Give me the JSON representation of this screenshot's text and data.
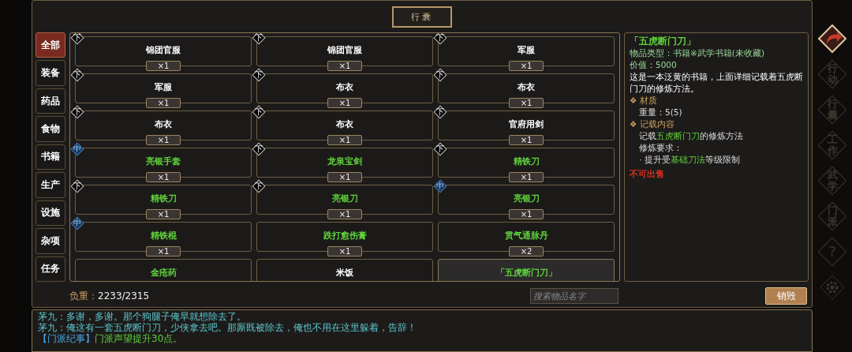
{
  "title": "行囊",
  "categories": [
    {
      "label": "全部",
      "selected": true
    },
    {
      "label": "装备",
      "selected": false
    },
    {
      "label": "药品",
      "selected": false
    },
    {
      "label": "食物",
      "selected": false
    },
    {
      "label": "书籍",
      "selected": false
    },
    {
      "label": "生产",
      "selected": false
    },
    {
      "label": "设施",
      "selected": false
    },
    {
      "label": "杂项",
      "selected": false
    },
    {
      "label": "任务",
      "selected": false
    }
  ],
  "items": [
    {
      "name": "锦团官服",
      "count": "×1",
      "grade": "下",
      "kind": "low",
      "color": "#ffffff",
      "selected": false
    },
    {
      "name": "锦团官服",
      "count": "×1",
      "grade": "下",
      "kind": "low",
      "color": "#ffffff",
      "selected": false
    },
    {
      "name": "军服",
      "count": "×1",
      "grade": "下",
      "kind": "low",
      "color": "#ffffff",
      "selected": false
    },
    {
      "name": "军服",
      "count": "×1",
      "grade": "下",
      "kind": "low",
      "color": "#ffffff",
      "selected": false
    },
    {
      "name": "布衣",
      "count": "×1",
      "grade": "下",
      "kind": "low",
      "color": "#ffffff",
      "selected": false
    },
    {
      "name": "布衣",
      "count": "×1",
      "grade": "下",
      "kind": "low",
      "color": "#ffffff",
      "selected": false
    },
    {
      "name": "布衣",
      "count": "×1",
      "grade": "下",
      "kind": "low",
      "color": "#ffffff",
      "selected": false
    },
    {
      "name": "布衣",
      "count": "×1",
      "grade": "下",
      "kind": "low",
      "color": "#ffffff",
      "selected": false
    },
    {
      "name": "官府用剑",
      "count": "×1",
      "grade": "下",
      "kind": "low",
      "color": "#ffffff",
      "selected": false
    },
    {
      "name": "亮银手套",
      "count": "×1",
      "grade": "中",
      "kind": "mid",
      "color": "#5fd43c",
      "selected": false
    },
    {
      "name": "龙泉宝剑",
      "count": "×1",
      "grade": "下",
      "kind": "low",
      "color": "#5fd43c",
      "selected": false
    },
    {
      "name": "精铁刀",
      "count": "×1",
      "grade": "下",
      "kind": "low",
      "color": "#5fd43c",
      "selected": false
    },
    {
      "name": "精铁刀",
      "count": "×1",
      "grade": "下",
      "kind": "low",
      "color": "#5fd43c",
      "selected": false
    },
    {
      "name": "亮银刀",
      "count": "×1",
      "grade": "下",
      "kind": "low",
      "color": "#5fd43c",
      "selected": false
    },
    {
      "name": "亮银刀",
      "count": "×1",
      "grade": "中",
      "kind": "mid",
      "color": "#5fd43c",
      "selected": false
    },
    {
      "name": "精铁棍",
      "count": "×1",
      "grade": "中",
      "kind": "mid",
      "color": "#5fd43c",
      "selected": false
    },
    {
      "name": "跌打愈伤膏",
      "count": "×1",
      "color": "#5fd43c",
      "selected": false
    },
    {
      "name": "贯气通脉丹",
      "count": "×2",
      "color": "#5fd43c",
      "selected": false
    },
    {
      "name": "金疮药",
      "color": "#5fd43c",
      "selected": false
    },
    {
      "name": "米饭",
      "color": "#ffffff",
      "selected": false
    },
    {
      "name": "「五虎断门刀」",
      "color": "#5fd43c",
      "selected": true
    }
  ],
  "detail": {
    "title": "「五虎断门刀」",
    "type": "物品类型：书籍※武学书籍(未收藏)",
    "value": "价值：5000",
    "description": "这是一本泛黄的书籍，上面详细记载着五虎断门刀的修炼方法。",
    "sections": [
      {
        "bullet": "❖",
        "heading": "材质",
        "lines": [
          [
            {
              "text": "重量：5(5)",
              "highlight": false
            }
          ]
        ]
      },
      {
        "bullet": "❖",
        "heading": "记载内容",
        "lines": [
          [
            {
              "text": "记载",
              "highlight": false
            },
            {
              "text": "五虎断门刀",
              "highlight": true
            },
            {
              "text": "的修炼方法",
              "highlight": false
            }
          ],
          [
            {
              "text": "修炼要求：",
              "highlight": false
            }
          ],
          [
            {
              "text": "· 提升受",
              "highlight": false
            },
            {
              "text": "基础刀法",
              "highlight": true
            },
            {
              "text": "等级限制",
              "highlight": false
            }
          ]
        ]
      }
    ],
    "note": "不可出售"
  },
  "weight_label": "负重：",
  "weight_value": "2233/2315",
  "search": {
    "placeholder": "搜索物品名字"
  },
  "destroy_button": "销毁",
  "log": [
    [
      {
        "text": "茅九：多谢，多谢。那个狗腿子俺早就想除去了。",
        "color": "#5cc8d0"
      }
    ],
    [
      {
        "text": "茅九：俺这有一套五虎断门刀，少侠拿去吧。那厮既被除去，俺也不用在这里躲着，告辞！",
        "color": "#5cc8d0"
      }
    ],
    [
      {
        "text": "【门派纪事】",
        "color": "#4aa8e8"
      },
      {
        "text": "门派声望提升30点。",
        "color": "#5fd43c"
      }
    ]
  ],
  "right_nav": [
    {
      "kind": "arrow"
    },
    {
      "kind": "text",
      "label": "行动"
    },
    {
      "kind": "text",
      "label": "行囊"
    },
    {
      "kind": "text",
      "label": "工作"
    },
    {
      "kind": "text",
      "label": "武学"
    },
    {
      "kind": "text",
      "label": "门派"
    },
    {
      "kind": "text",
      "label": "?"
    },
    {
      "kind": "gear"
    }
  ]
}
